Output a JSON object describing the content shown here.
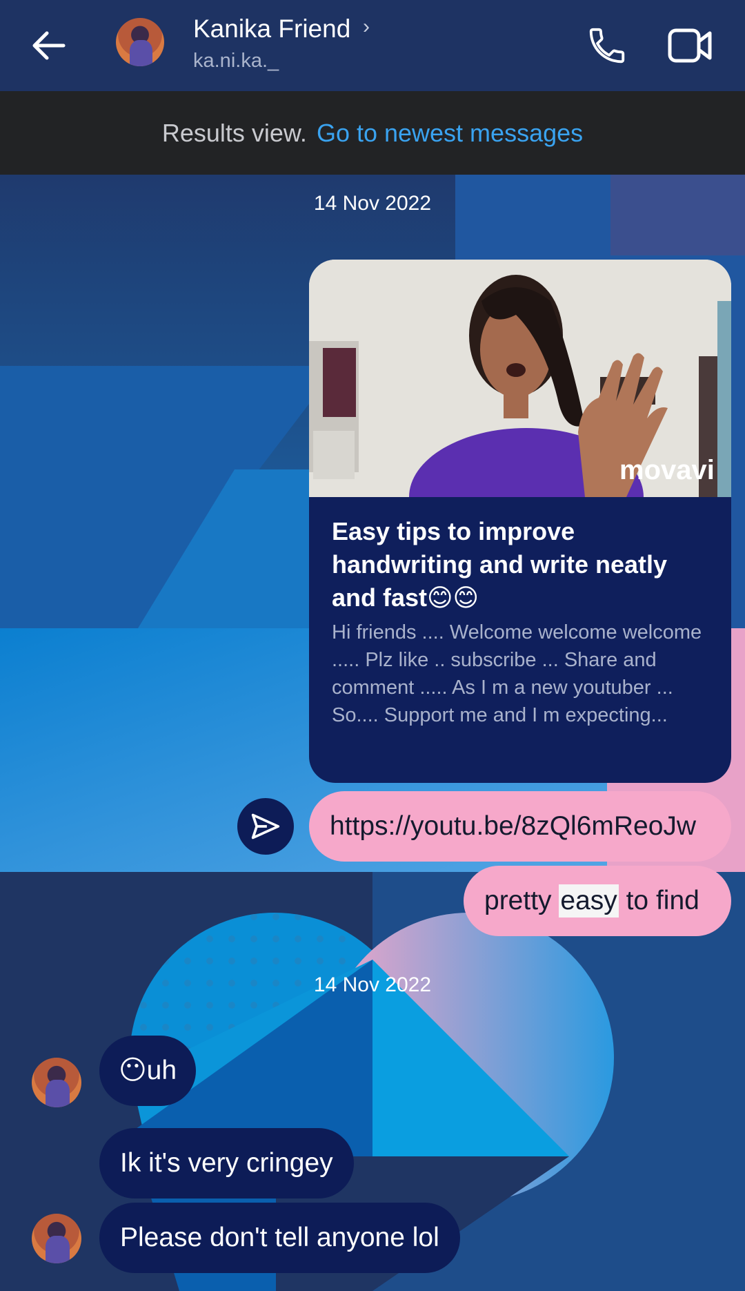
{
  "header": {
    "back_icon": "arrow-left-icon",
    "contact_name": "Kanika Friend",
    "chevron": "›",
    "username": "ka.ni.ka._",
    "call_icon": "phone-icon",
    "video_icon": "video-camera-icon"
  },
  "results_bar": {
    "text": "Results view.",
    "link": "Go to newest messages"
  },
  "messages": {
    "date1": "14 Nov 2022",
    "share_card": {
      "watermark": "movavi",
      "title": "Easy tips to improve handwriting and write neatly and fast😊😊",
      "description": "Hi friends .... Welcome welcome welcome ..... Plz like .. subscribe ... Share and comment ..... As I m a new youtuber ... So.... Support me and I m expecting..."
    },
    "link_bubble": "https://youtu.be/8zQl6mReoJw",
    "easy_bubble": {
      "before": "pretty ",
      "highlight": "easy",
      "after": " to find"
    },
    "date2": "14 Nov 2022",
    "received": [
      "😶uh",
      "Ik it's very cringey",
      "Please don't tell anyone lol"
    ]
  },
  "colors": {
    "header_bg": "#1e3363",
    "banner_bg": "#222325",
    "link_blue": "#3aa3f0",
    "sent_bubble": "#f6a8ca",
    "received_bubble": "#0d1c57"
  }
}
